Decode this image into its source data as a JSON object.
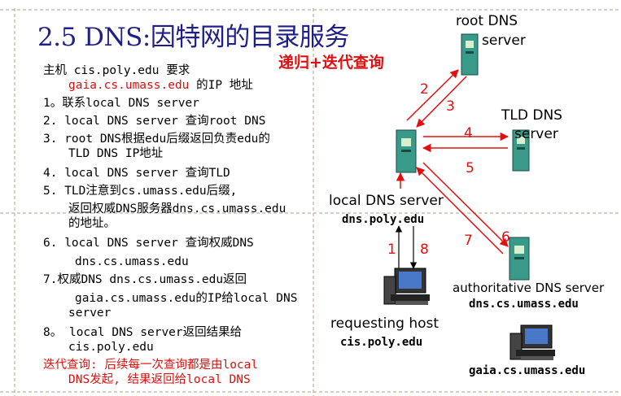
{
  "slide": {
    "title": "2.5 DNS:因特网的目录服务",
    "subtitle": "递归+迭代查询"
  },
  "steps": {
    "s0_line1": "主机 cis.poly.edu 要求",
    "s0_line2_red": "gaia.cs.umass.edu",
    "s0_line2_rest": " 的IP 地址",
    "s1": "1。联系local DNS server",
    "s2": "2. local DNS server 查询root DNS",
    "s3_line1": "3. root DNS根据edu后缀返回负责edu的",
    "s3_line2": "TLD DNS IP地址",
    "s4": "4. local DNS server 查询TLD",
    "s5_line1": "5. TLD注意到cs.umass.edu后缀,",
    "s5_line2": "返回权威DNS服务器dns.cs.umass.edu",
    "s5_line3": "的地址。",
    "s6_line1": "6. local DNS server 查询权威DNS",
    "s6_line2": "dns.cs.umass.edu",
    "s7_line1": "7.权威DNS dns.cs.umass.edu返回",
    "s7_line2": "gaia.cs.umass.edu的IP给local DNS",
    "s7_line3": "server",
    "s8_line1": "8。 local DNS server返回结果给",
    "s8_line2": "cis.poly.edu",
    "note_line1": "迭代查询: 后续每一次查询都是由local",
    "note_line2": "DNS发起, 结果返回给local DNS"
  },
  "diagram": {
    "root_label_line1": "root DNS",
    "root_label_line2": "server",
    "tld_label_line1": "TLD DNS",
    "tld_label_line2": "server",
    "local_label": "local DNS server",
    "local_host": "dns.poly.edu",
    "auth_label": "authoritative DNS server",
    "auth_host": "dns.cs.umass.edu",
    "req_label": "requesting host",
    "req_host": "cis.poly.edu",
    "gaia_host": "gaia.cs.umass.edu",
    "arrow_numbers": [
      "1",
      "2",
      "3",
      "4",
      "5",
      "6",
      "7",
      "8"
    ]
  },
  "colors": {
    "title": "#1f1f8c",
    "accent_red": "#e01010",
    "server_fill": "#3a9a8a",
    "server_screen": "#d8f0d0"
  }
}
